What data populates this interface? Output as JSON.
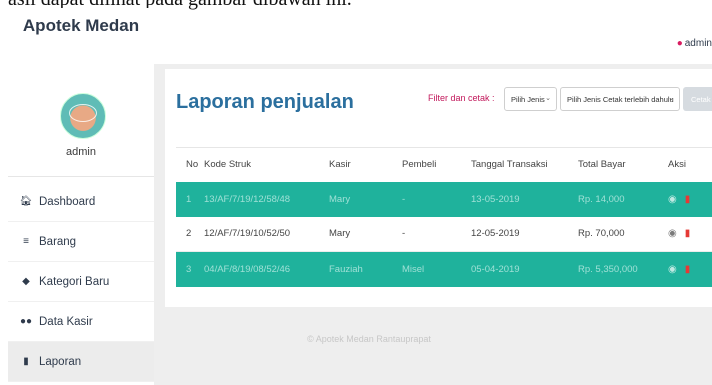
{
  "caption": "asil dapat dilihat pada gambar dibawah ini.",
  "sidebar": {
    "brand": "Apotek Medan",
    "user_name": "admin",
    "items": [
      {
        "label": "Dashboard",
        "icon": "home-icon"
      },
      {
        "label": "Barang",
        "icon": "list-icon"
      },
      {
        "label": "Kategori Baru",
        "icon": "tag-icon"
      },
      {
        "label": "Data Kasir",
        "icon": "users-icon"
      },
      {
        "label": "Laporan",
        "icon": "book-icon"
      }
    ]
  },
  "header": {
    "user": "admin",
    "user_icon": "user-icon"
  },
  "report": {
    "title": "Laporan penjualan",
    "filter_label": "Filter dan cetak :",
    "select_type": {
      "value": "Pilih Jenis"
    },
    "select_print": {
      "value": "Pilih Jenis Cetak terlebih dahulu"
    },
    "print_button": "Cetak"
  },
  "table": {
    "headers": [
      "No",
      "Kode Struk",
      "Kasir",
      "Pembeli",
      "Tanggal Transaksi",
      "Total Bayar",
      "Aksi"
    ],
    "rows": [
      {
        "no": "1",
        "kode": "13/AF/7/19/12/58/48",
        "kasir": "Mary",
        "pembeli": "-",
        "tanggal": "13-05-2019",
        "total": "Rp. 14,000"
      },
      {
        "no": "2",
        "kode": "12/AF/7/19/10/52/50",
        "kasir": "Mary",
        "pembeli": "-",
        "tanggal": "12-05-2019",
        "total": "Rp. 70,000"
      },
      {
        "no": "3",
        "kode": "04/AF/8/19/08/52/46",
        "kasir": "Fauziah",
        "pembeli": "Misel",
        "tanggal": "05-04-2019",
        "total": "Rp. 5,350,000"
      }
    ]
  },
  "footer": "© Apotek Medan Rantauprapat",
  "colors": {
    "accent": "#1fb29c",
    "title": "#2b6f9e",
    "filter": "#c2185b",
    "delete": "#e53935"
  }
}
